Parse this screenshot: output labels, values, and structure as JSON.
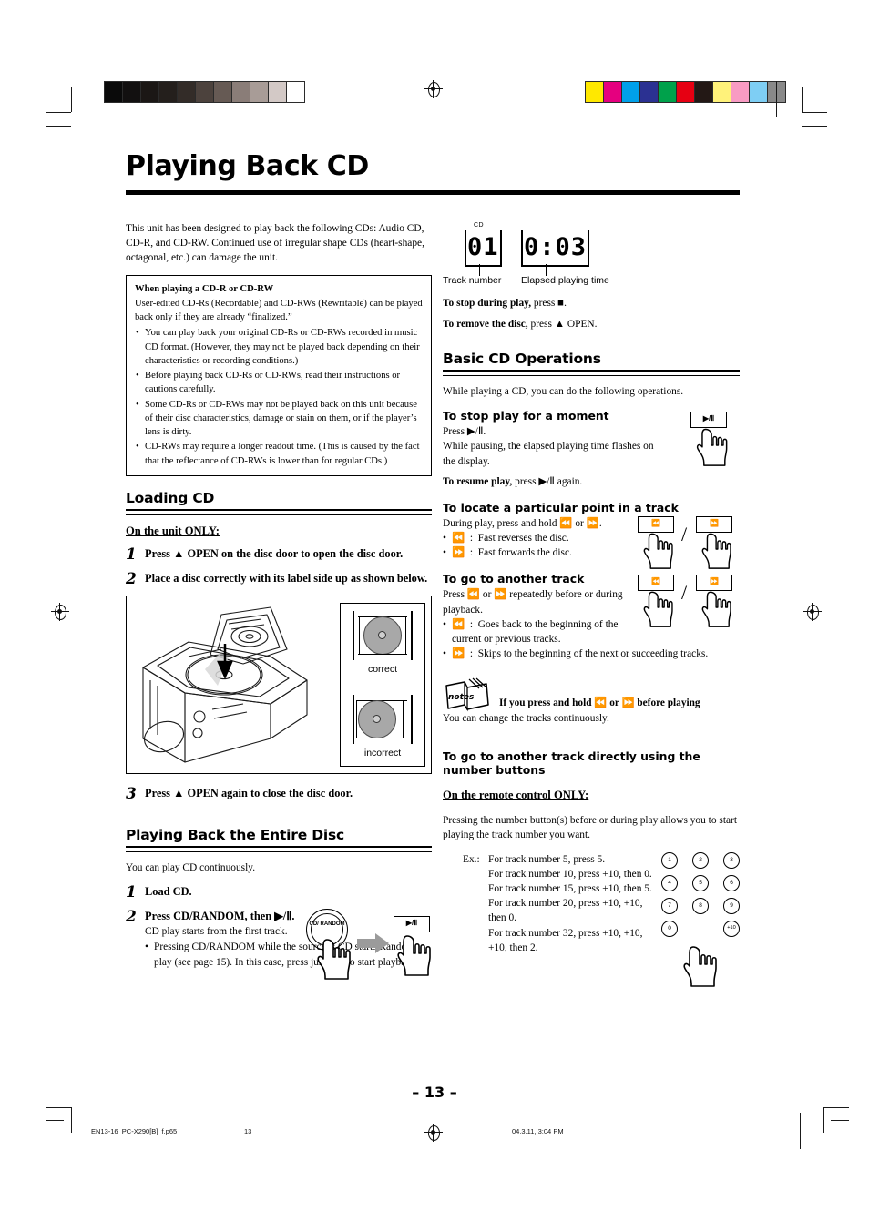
{
  "header": {
    "title": "Playing Back CD"
  },
  "left": {
    "intro": "This unit has been designed to play back the following CDs: Audio CD, CD-R, and CD-RW. Continued use of irregular shape CDs (heart-shape, octagonal, etc.) can damage the unit.",
    "notebox": {
      "title": "When playing a CD-R or CD-RW",
      "lead": "User-edited CD-Rs (Recordable) and CD-RWs (Rewritable) can be played back only if they are already “finalized.”",
      "bullets": [
        "You can play back your original CD-Rs or CD-RWs recorded in music CD format. (However, they may not be played back depending on their characteristics or recording conditions.)",
        "Before playing back CD-Rs or CD-RWs, read their instructions or cautions carefully.",
        "Some CD-Rs or CD-RWs may not be played back on this unit because of their disc characteristics, damage or stain on them, or if the player’s lens is dirty.",
        "CD-RWs may require a longer readout time. (This is caused by the fact that the reflectance of CD-RWs is lower than for regular CDs.)"
      ]
    },
    "loading": {
      "heading": "Loading CD",
      "only_label": "On the unit ONLY:",
      "step1_num": "1",
      "step1_text": "Press ▲ OPEN on the disc door to open the disc door.",
      "step2_num": "2",
      "step2_text": "Place a disc correctly with its label side up as shown below.",
      "step3_num": "3",
      "step3_text": "Press ▲ OPEN again to close the disc door.",
      "illustration": {
        "correct_label": "correct",
        "incorrect_label": "incorrect"
      }
    },
    "entire": {
      "heading": "Playing Back the Entire Disc",
      "intro": "You can play CD continuously.",
      "step1_num": "1",
      "step1_text": "Load CD.",
      "step2_num": "2",
      "step2_text": "Press CD/RANDOM, then ▶/Ⅱ.",
      "step2_note": "CD play starts from the first track.",
      "step2_bullet": "Pressing CD/RANDOM while the source is CD starts Random play (see page 15). In this case, press just ▶/Ⅱ to start playback.",
      "button_cd_random": "CD/ RANDOM",
      "button_play_pause": "▶/Ⅱ"
    }
  },
  "right": {
    "display": {
      "cd_indicator": "CD",
      "track_value": "01",
      "time_value": "0:03",
      "track_label": "Track number",
      "time_label": "Elapsed playing time"
    },
    "stop_line_bold": "To stop during play,",
    "stop_line_rest": " press ■.",
    "remove_line_bold": "To remove the disc,",
    "remove_line_rest": " press ▲ OPEN.",
    "basic": {
      "heading": "Basic CD Operations",
      "intro": "While playing a CD, you can do the following operations.",
      "pause": {
        "heading": "To stop play for a moment",
        "line1": "Press ▶/Ⅱ.",
        "line2": "While pausing, the elapsed playing time flashes on the display.",
        "resume_bold": "To resume play,",
        "resume_rest": " press ▶/Ⅱ again.",
        "button_label": "▶/Ⅱ"
      },
      "locate": {
        "heading": "To locate a particular point in a track",
        "intro": "During play, press and hold ⏪ or ⏩.",
        "bullets": [
          {
            "key": "⏪",
            "desc": "Fast reverses the disc."
          },
          {
            "key": "⏩",
            "desc": "Fast forwards the disc."
          }
        ],
        "button_prev": "⏪",
        "button_next": "⏩"
      },
      "another": {
        "heading": "To go to another track",
        "intro": "Press ⏪ or ⏩ repeatedly before or during playback.",
        "bullets": [
          {
            "key": "⏪",
            "desc": "Goes back to the beginning of the current or previous tracks."
          },
          {
            "key": "⏩",
            "desc": "Skips to the beginning of the next or succeeding tracks."
          }
        ]
      },
      "notes": {
        "icon_label": "notes",
        "head": "If you press and hold ⏪ or ⏩ before playing",
        "body": "You can change the tracks continuously."
      },
      "direct": {
        "heading": "To go to another track directly using the number buttons",
        "only_label": "On the remote control ONLY:",
        "intro": "Pressing the number button(s) before or during play allows you to start playing the track number you want.",
        "ex_label": "Ex.:",
        "examples": [
          "For track number 5, press 5.",
          "For track number 10, press +10, then 0.",
          "For track number 15, press +10, then 5.",
          "For track number 20, press +10, +10, then 0.",
          "For track number 32, press +10, +10, +10, then 2."
        ],
        "keypad": [
          [
            "1",
            "2",
            "3"
          ],
          [
            "4",
            "5",
            "6"
          ],
          [
            "7",
            "8",
            "9"
          ],
          [
            "0",
            "",
            "+10"
          ]
        ]
      }
    }
  },
  "footer": {
    "page_number": "– 13 –",
    "file_name": "EN13-16_PC-X290[B]_f.p65",
    "page_index": "13",
    "timestamp": "04.3.11, 3:04 PM"
  },
  "print_marks": {
    "gray_steps": [
      "#0a0a0a",
      "#121010",
      "#1b1715",
      "#241f1c",
      "#332c28",
      "#4c423d",
      "#665a54",
      "#8a7d78",
      "#a89c97",
      "#d3c9c6",
      "#ffffff"
    ],
    "color_bars": [
      "#ffe800",
      "#e5007f",
      "#00a0e9",
      "#2b3192",
      "#00a14b",
      "#e60012",
      "#231815",
      "#fff27a",
      "#f89bc3",
      "#7ecef4",
      "#898989"
    ]
  }
}
